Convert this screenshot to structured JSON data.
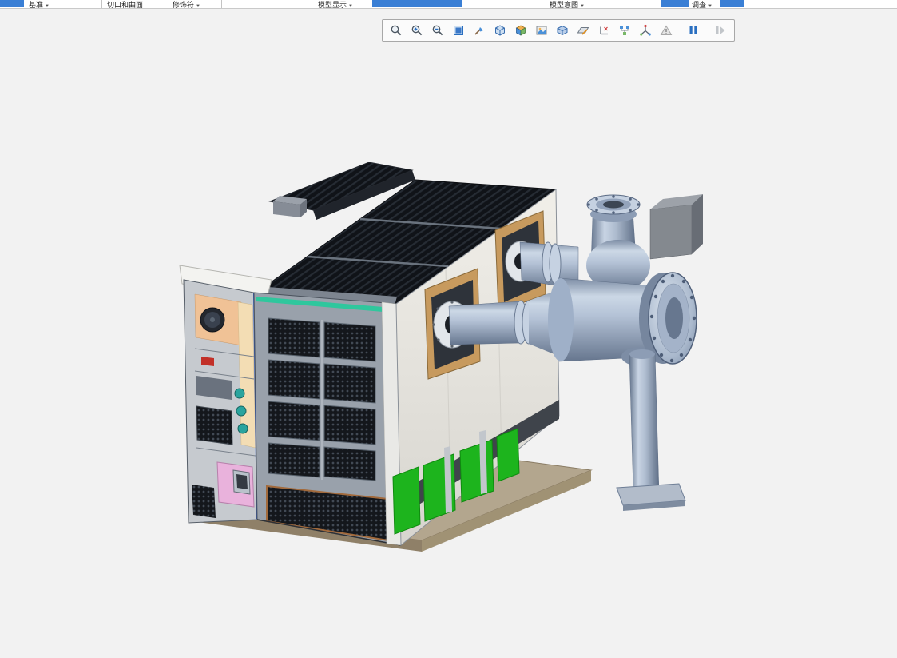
{
  "ribbon": {
    "dropdown_arrow": "▼",
    "groups": [
      {
        "label": "基准"
      },
      {
        "label": "切口和曲面"
      },
      {
        "label": "修饰符"
      },
      {
        "label": "模型显示"
      },
      {
        "label": "模型意图"
      },
      {
        "label": "调查"
      }
    ]
  },
  "toolbar": {
    "tools": [
      {
        "name": "zoom-region"
      },
      {
        "name": "zoom-in"
      },
      {
        "name": "zoom-out"
      },
      {
        "name": "refit"
      },
      {
        "name": "repaint"
      },
      {
        "name": "display-style"
      },
      {
        "name": "saved-orientations"
      },
      {
        "name": "view-images"
      },
      {
        "name": "perspective-view"
      },
      {
        "name": "plane-display"
      },
      {
        "name": "annotation-display"
      },
      {
        "name": "model-tree-filter"
      },
      {
        "name": "spin-center"
      },
      {
        "name": "simulation-warning"
      },
      {
        "name": "pause"
      },
      {
        "name": "resume"
      }
    ]
  },
  "colors": {
    "ribbon_accent_blue": "#3a7fd5",
    "canvas_bg": "#f2f2f2",
    "skid_tan": "#b3a68e",
    "skid_edge": "#8f8068",
    "floor_green": "#1db41d",
    "mesh_dark": "#14171c",
    "frame_gray": "#99a1ab",
    "panel_white": "#edeae4",
    "cabinet_gray": "#c6cacf",
    "window_bronze": "#c79a5e",
    "teal_rail": "#2fc79d",
    "peach_panel": "#f0c296",
    "pink_panel": "#e9b2dc",
    "pipe_steel": "#aebccf"
  }
}
